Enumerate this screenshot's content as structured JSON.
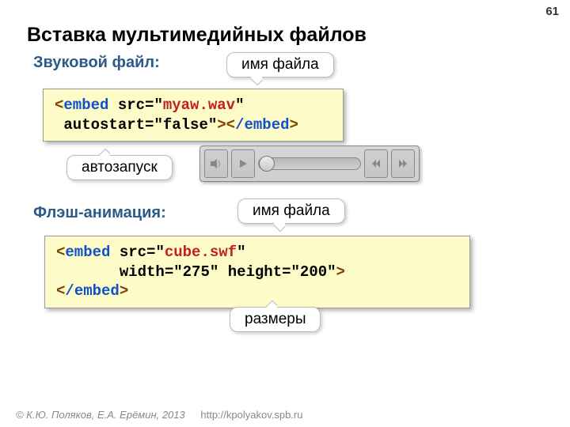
{
  "slide_number": "61",
  "title": "Вставка мультимедийных файлов",
  "section_sound": "Звуковой файл:",
  "section_flash": "Флэш-анимация:",
  "callouts": {
    "filename1": "имя файла",
    "autostart": "автозапуск",
    "filename2": "имя файла",
    "size": "размеры"
  },
  "code1": {
    "open": "<",
    "tag": "embed",
    "sp": " ",
    "attr_src": "src=",
    "q": "\"",
    "val_src": "myaw.wav",
    "nl": "\n ",
    "attr_auto": "autostart=",
    "val_auto": "false",
    "close1": ">",
    "close_open": "<",
    "slash": "/",
    "close2": ">"
  },
  "code2": {
    "open": "<",
    "tag": "embed",
    "sp": " ",
    "attr_src": "src=",
    "q": "\"",
    "val_src": "cube.swf",
    "nl1": "\n       ",
    "attr_w": "width=",
    "val_w": "275",
    "sp2": " ",
    "attr_h": "height=",
    "val_h": "200",
    "close1": ">",
    "nl2": "\n",
    "close_open": "<",
    "slash": "/",
    "close2": ">"
  },
  "footer": {
    "copyright": "© К.Ю. Поляков, Е.А. Ерёмин, 2013",
    "url": "http://kpolyakov.spb.ru"
  }
}
